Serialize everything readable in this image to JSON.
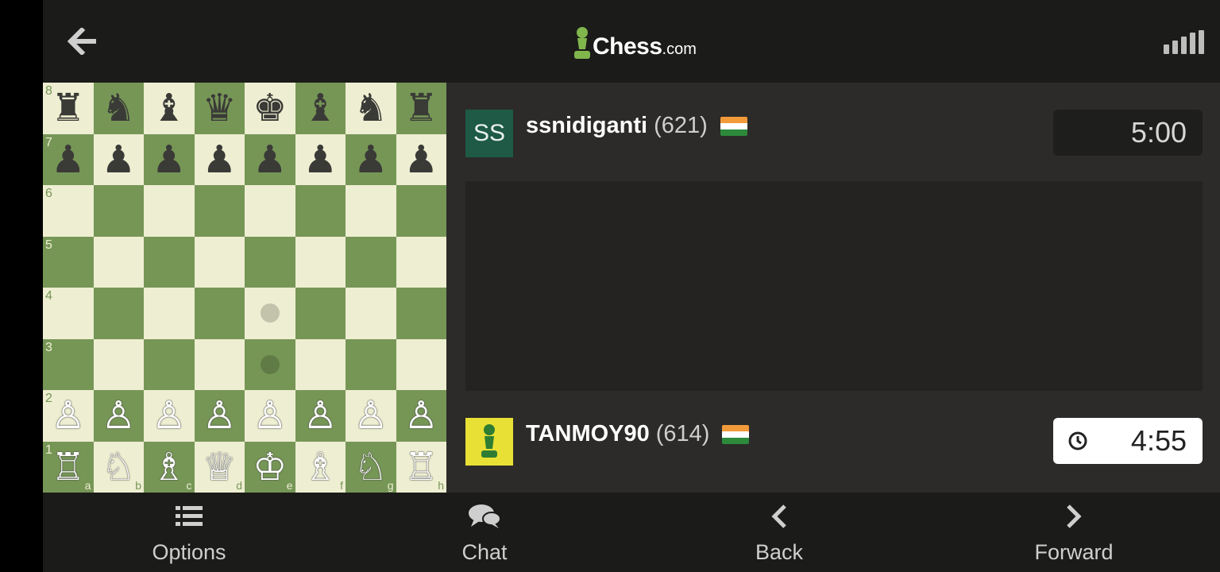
{
  "topbar": {
    "back_icon": "back-arrow-icon",
    "logo_main": "Chess",
    "logo_suffix": ".com",
    "signal_icon": "signal-bars-icon"
  },
  "board": {
    "files": [
      "a",
      "b",
      "c",
      "d",
      "e",
      "f",
      "g",
      "h"
    ],
    "ranks": [
      "8",
      "7",
      "6",
      "5",
      "4",
      "3",
      "2",
      "1"
    ],
    "rows": [
      [
        "♜",
        "♞",
        "♝",
        "♛",
        "♚",
        "♝",
        "♞",
        "♜"
      ],
      [
        "♟",
        "♟",
        "♟",
        "♟",
        "♟",
        "♟",
        "♟",
        "♟"
      ],
      [
        "",
        "",
        "",
        "",
        "",
        "",
        "",
        ""
      ],
      [
        "",
        "",
        "",
        "",
        "",
        "",
        "",
        ""
      ],
      [
        "",
        "",
        "",
        "",
        "",
        "",
        "",
        ""
      ],
      [
        "",
        "",
        "",
        "",
        "",
        "",
        "",
        ""
      ],
      [
        "♙",
        "♙",
        "♙",
        "♙",
        "♙",
        "♙",
        "♙",
        "♙"
      ],
      [
        "♖",
        "♘",
        "♗",
        "♕",
        "♔",
        "♗",
        "♘",
        "♖"
      ]
    ],
    "piece_colors": [
      "black",
      "black",
      "",
      "",
      "",
      "",
      "white",
      "white"
    ],
    "move_hints": [
      "e4",
      "e3"
    ],
    "light_color": "#eeeed2",
    "dark_color": "#769656"
  },
  "opponent": {
    "avatar_text": "SS",
    "username": "ssnidiganti",
    "rating": "(621)",
    "country": "India",
    "clock": "5:00"
  },
  "player": {
    "avatar_icon": "pawn-avatar-icon",
    "username": "TANMOY90",
    "rating": "(614)",
    "country": "India",
    "clock": "4:55",
    "clock_icon": "clock-icon"
  },
  "bottom_nav": {
    "options_label": "Options",
    "chat_label": "Chat",
    "back_label": "Back",
    "forward_label": "Forward"
  }
}
